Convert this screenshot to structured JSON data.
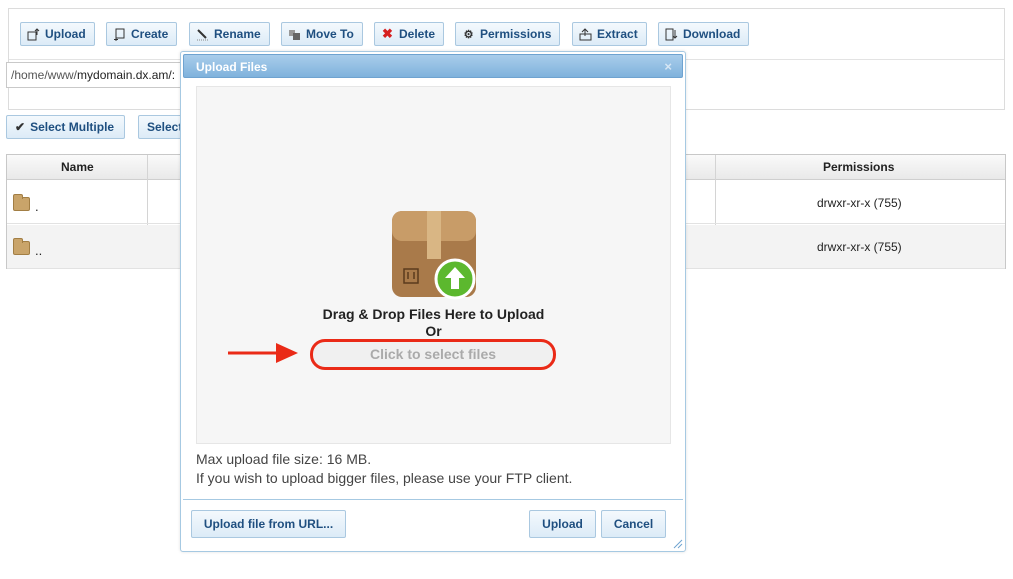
{
  "toolbar": {
    "upload": "Upload",
    "create": "Create",
    "rename": "Rename",
    "move_to": "Move To",
    "delete": "Delete",
    "permissions": "Permissions",
    "extract": "Extract",
    "download": "Download"
  },
  "path": {
    "prefix": "/home/www/",
    "domain": "mydomain.dx.am/:"
  },
  "selection": {
    "select_multiple": "Select Multiple",
    "select_all": "Select All"
  },
  "grid": {
    "headers": {
      "name": "Name",
      "permissions": "Permissions"
    },
    "rows": [
      {
        "name": ".",
        "permissions": "drwxr-xr-x (755)"
      },
      {
        "name": "..",
        "permissions": "drwxr-xr-x (755)"
      }
    ]
  },
  "dialog": {
    "title": "Upload Files",
    "close": "×",
    "drop_text": "Drag & Drop Files Here to Upload",
    "or_text": "Or",
    "select_files": "Click to select files",
    "max_size": "Max upload file size: 16 MB.",
    "ftp_note": "If you wish to upload bigger files, please use your FTP client.",
    "upload_url": "Upload file from URL...",
    "upload": "Upload",
    "cancel": "Cancel"
  },
  "colors": {
    "accent_red": "#ea2a17",
    "button_text": "#1f4f80",
    "title_bar": "#7fb2dc",
    "upload_green": "#5cb82e"
  }
}
